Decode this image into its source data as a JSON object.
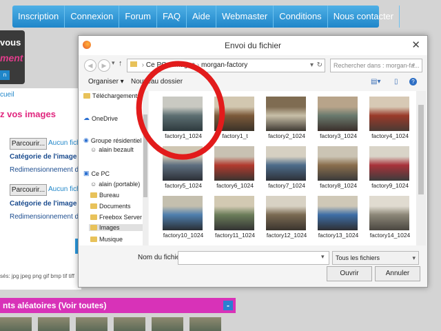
{
  "nav": {
    "items": [
      "Inscription",
      "Connexion",
      "Forum",
      "FAQ",
      "Aide",
      "Webmaster",
      "Conditions",
      "Nous contacter"
    ]
  },
  "promo": {
    "line1": "vous",
    "line2": "ment",
    "line3": "n"
  },
  "page": {
    "breadcrumb": "cueil",
    "title": "z vos images",
    "browse_label": "Parcourir...",
    "no_file": "Aucun fichi",
    "category_label": "Catégorie de l'image :",
    "resize_label": "Redimensionnement de l",
    "extensions": "sés: jpg jpeg png gif bmp tif tiff",
    "random_title": "nts aléatoires (Voir toutes)",
    "minus": "-"
  },
  "dialog": {
    "title": "Envoi du fichier",
    "close": "✕",
    "path": [
      "Ce PC",
      "Images",
      "morgan-factory"
    ],
    "search_placeholder": "Rechercher dans : morgan-fa...",
    "toolbar": {
      "organize": "Organiser ▾",
      "new_folder": "Nouveau dossier"
    },
    "nav_items": [
      {
        "label": "Téléchargements",
        "icon": "download-folder-icon"
      },
      {
        "label": "OneDrive",
        "icon": "cloud-icon"
      },
      {
        "label": "Groupe résidentiel",
        "icon": "homegroup-icon"
      },
      {
        "label": "alain bezault",
        "icon": "user-icon"
      },
      {
        "label": "Ce PC",
        "icon": "computer-icon"
      },
      {
        "label": "alain (portable)",
        "icon": "user-icon"
      },
      {
        "label": "Bureau",
        "icon": "folder-icon"
      },
      {
        "label": "Documents",
        "icon": "folder-icon"
      },
      {
        "label": "Freebox Server",
        "icon": "folder-icon"
      },
      {
        "label": "Images",
        "icon": "folder-icon",
        "selected": true
      },
      {
        "label": "Musique",
        "icon": "folder-icon"
      }
    ],
    "files": [
      "factory1_1024",
      "factory1_t",
      "factory2_1024",
      "factory3_1024",
      "factory4_1024",
      "factory5_1024",
      "factory6_1024",
      "factory7_1024",
      "factory8_1024",
      "factory9_1024",
      "factory10_1024",
      "factory11_1024",
      "factory12_1024",
      "factory13_1024",
      "factory14_1024"
    ],
    "filename_label": "Nom du fichier :",
    "filename_value": "",
    "filter": "Tous les fichiers",
    "open": "Ouvrir",
    "cancel": "Annuler"
  },
  "colors": {
    "nav": "#1f86c9",
    "accent_pink": "#e0257e",
    "annotation": "#e21b1b"
  }
}
